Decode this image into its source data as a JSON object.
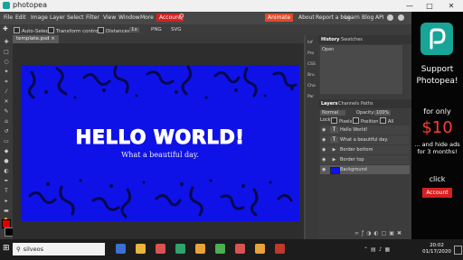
{
  "window": {
    "title": "photopea",
    "minimize": "—",
    "maximize": "□",
    "close": "✕"
  },
  "menu": {
    "items": [
      "File",
      "Edit",
      "Image",
      "Layer",
      "Select",
      "Filter",
      "View",
      "Window",
      "More"
    ],
    "account": "Account",
    "right": {
      "animate": "Animate",
      "about": "About",
      "report": "Report a bug",
      "learn": "Learn",
      "blog": "Blog",
      "api": "API"
    }
  },
  "options": {
    "auto_select": "Auto-Select",
    "transform": "Transform controls",
    "distances": "Distances",
    "zoom": "1x",
    "png": "PNG",
    "svg": "SVG"
  },
  "document": {
    "tab_name": "template.psd",
    "close": "×",
    "hello": "HELLO WORLD!",
    "subtitle": "What a beautiful day."
  },
  "minipanel": [
    "Inf",
    "Pro",
    "CSS",
    "Bru",
    "Cha",
    "Par"
  ],
  "history": {
    "tabs": [
      "History",
      "Swatches"
    ],
    "items": [
      "Open"
    ]
  },
  "layers": {
    "tabs": [
      "Layers",
      "Channels",
      "Paths"
    ],
    "blend_mode": "Normal",
    "opacity_label": "Opacity:",
    "opacity_value": "100%",
    "lock_label": "Lock:",
    "pixels": "Pixels",
    "position": "Position",
    "all": "All",
    "items": [
      {
        "name": "Hello World!",
        "type": "text"
      },
      {
        "name": "What a beautiful day.",
        "type": "text"
      },
      {
        "name": "Border bottom",
        "type": "folder"
      },
      {
        "name": "Border top",
        "type": "folder"
      },
      {
        "name": "Background",
        "type": "fill"
      }
    ]
  },
  "ad": {
    "line1": "Support",
    "line2": "Photopea!",
    "line3": "for only",
    "price": "$10",
    "line4": "... and hide ads",
    "line5": "for 3 months!",
    "click": "click",
    "button": "Account"
  },
  "taskbar": {
    "search_text": "silveos",
    "time": "20:02",
    "date": "01/17/2020"
  },
  "colors": {
    "canvas": "#0f12e6",
    "accent": "#d42020",
    "brand": "#18a497"
  }
}
